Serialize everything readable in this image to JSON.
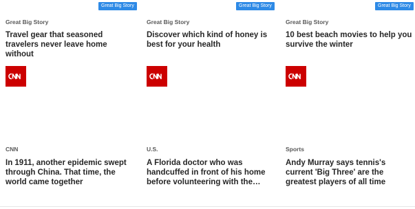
{
  "badge_label": "Great Big Story",
  "cards": [
    {
      "section": "Great Big Story",
      "headline": "Travel gear that seasoned travelers never leave home without",
      "logo": "cnn-logo"
    },
    {
      "section": "Great Big Story",
      "headline": "Discover which kind of honey is best for your health",
      "logo": "cnn-logo"
    },
    {
      "section": "Great Big Story",
      "headline": "10 best beach movies to help you survive the winter",
      "logo": "cnn-logo"
    },
    {
      "section": "CNN",
      "headline": "In 1911, another epidemic swept through China. That time, the world came together"
    },
    {
      "section": "U.S.",
      "headline": "A Florida doctor who was handcuffed in front of his home before volunteering with the…"
    },
    {
      "section": "Sports",
      "headline": "Andy Murray says tennis's current 'Big Three' are the greatest players of all time"
    }
  ],
  "colors": {
    "badge": "#2e8ae6",
    "cnn_red": "#cc0000",
    "section": "#595959",
    "headline": "#262626"
  }
}
